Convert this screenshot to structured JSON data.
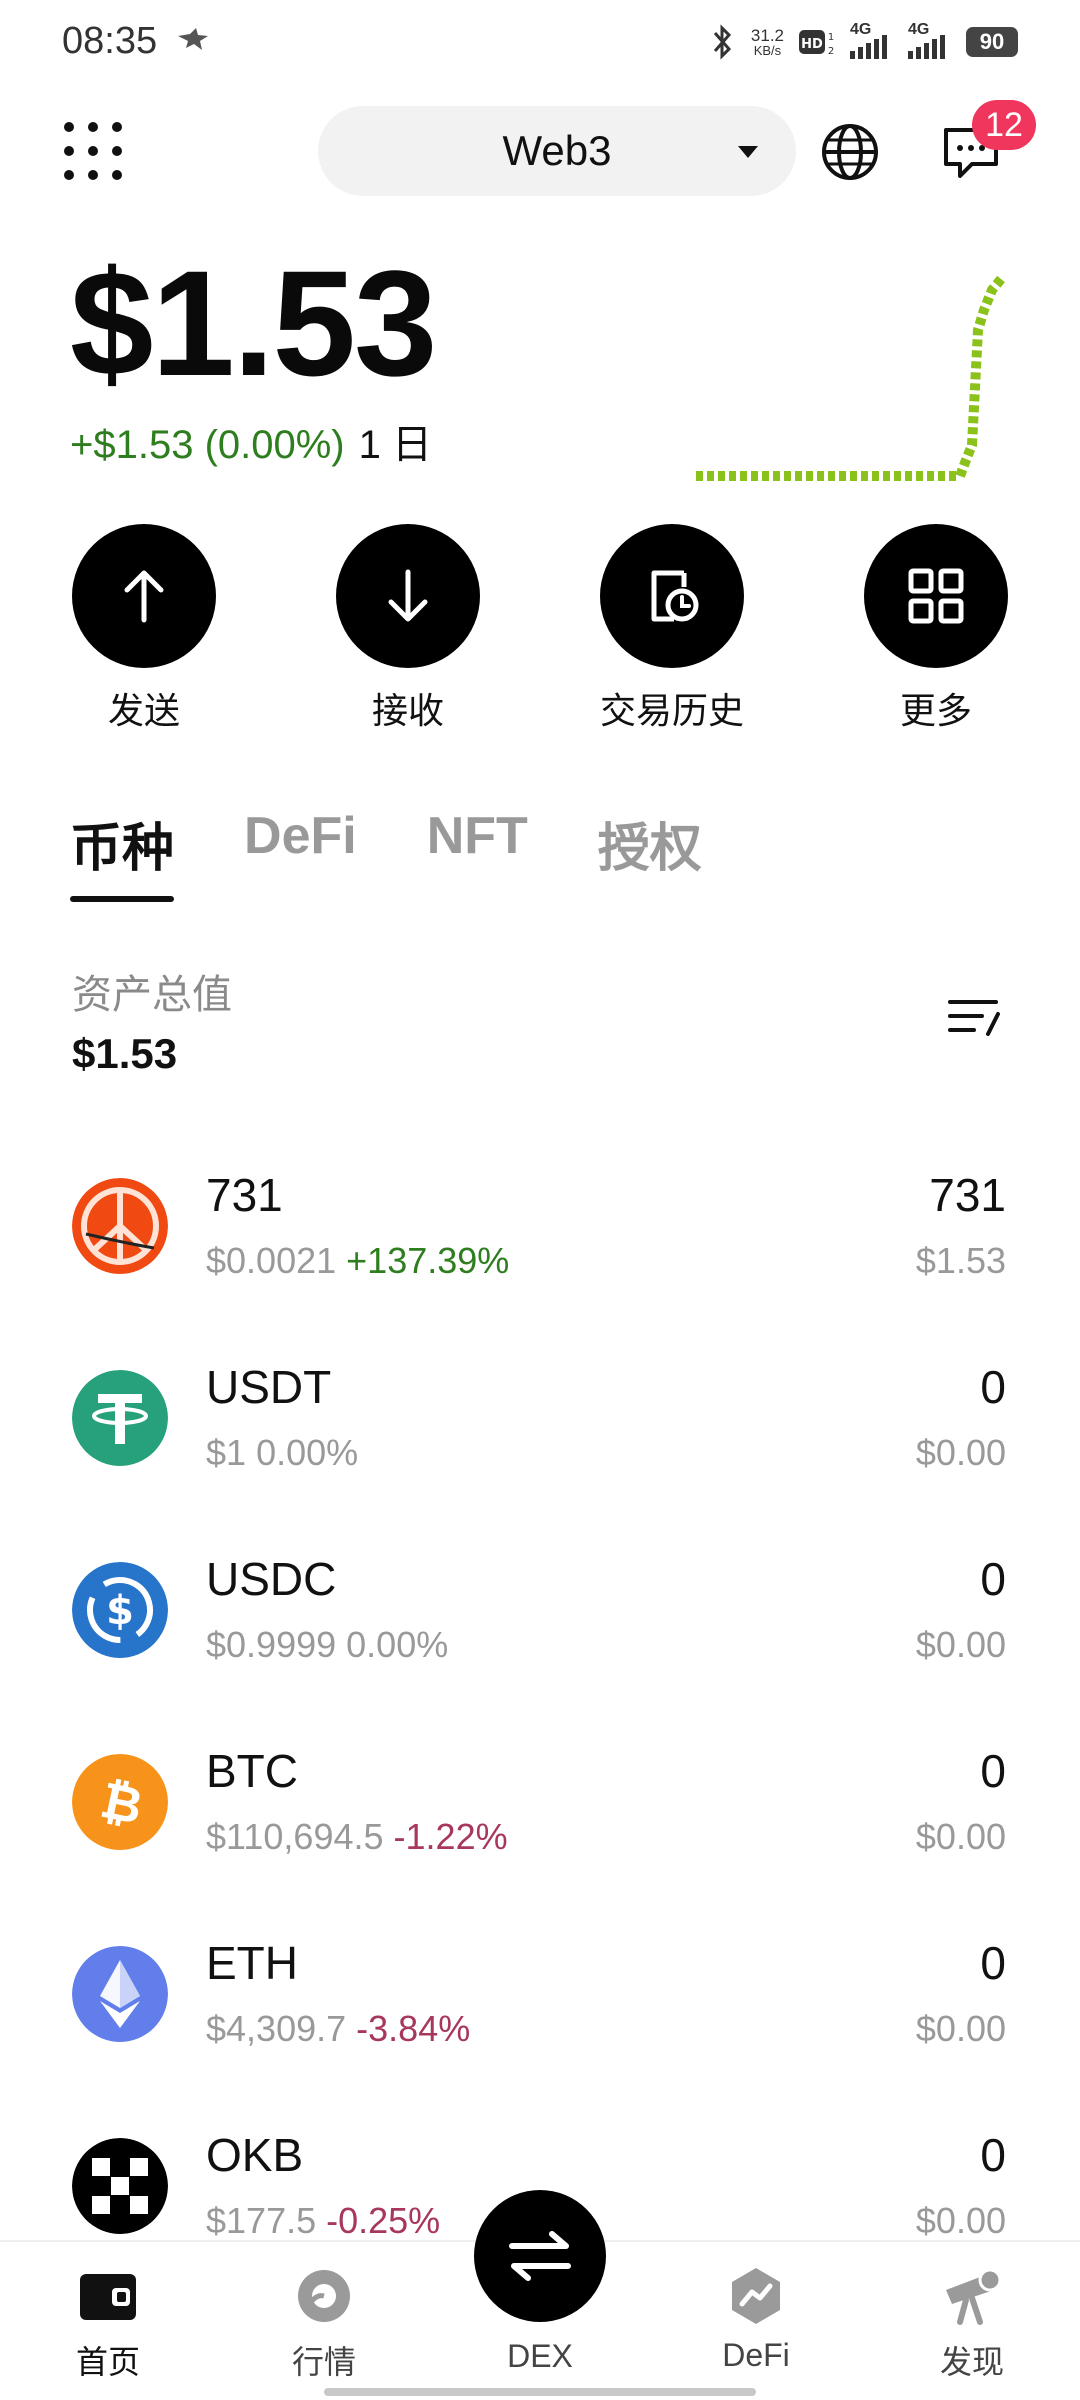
{
  "status_bar": {
    "time": "08:35",
    "net_speed_value": "31.2",
    "net_speed_unit": "KB/s",
    "network_1": "4G",
    "network_2": "4G",
    "battery": "90"
  },
  "header": {
    "wallet_label": "Web3",
    "notification_count": "12"
  },
  "balance": {
    "total": "$1.53",
    "change": "+$1.53 (0.00%)",
    "period": "1 日"
  },
  "actions": [
    {
      "label": "发送",
      "icon": "arrow-up-icon"
    },
    {
      "label": "接收",
      "icon": "arrow-down-icon"
    },
    {
      "label": "交易历史",
      "icon": "history-icon"
    },
    {
      "label": "更多",
      "icon": "grid-icon"
    }
  ],
  "tabs": [
    {
      "label": "币种",
      "active": true
    },
    {
      "label": "DeFi",
      "active": false
    },
    {
      "label": "NFT",
      "active": false
    },
    {
      "label": "授权",
      "active": false
    }
  ],
  "assets": {
    "label": "资产总值",
    "total": "$1.53"
  },
  "tokens": [
    {
      "symbol": "731",
      "price": "$0.0021",
      "change": "+137.39%",
      "amount": "731",
      "value": "$1.53",
      "logo_color": "#f04a12"
    },
    {
      "symbol": "USDT",
      "price": "$1",
      "change": "0.00%",
      "amount": "0",
      "value": "$0.00",
      "logo_color": "#26a17b"
    },
    {
      "symbol": "USDC",
      "price": "$0.9999",
      "change": "0.00%",
      "amount": "0",
      "value": "$0.00",
      "logo_color": "#2775ca"
    },
    {
      "symbol": "BTC",
      "price": "$110,694.5",
      "change": "-1.22%",
      "amount": "0",
      "value": "$0.00",
      "logo_color": "#f7931a"
    },
    {
      "symbol": "ETH",
      "price": "$4,309.7",
      "change": "-3.84%",
      "amount": "0",
      "value": "$0.00",
      "logo_color": "#627eea"
    },
    {
      "symbol": "OKB",
      "price": "$177.5",
      "change": "-0.25%",
      "amount": "0",
      "value": "$0.00",
      "logo_color": "#000000"
    }
  ],
  "bottom_nav": [
    {
      "label": "首页",
      "icon": "wallet-icon",
      "active": true
    },
    {
      "label": "行情",
      "icon": "market-icon",
      "active": false
    },
    {
      "label": "DEX",
      "icon": "swap-icon",
      "active": false
    },
    {
      "label": "DeFi",
      "icon": "defi-icon",
      "active": false
    },
    {
      "label": "发现",
      "icon": "discover-icon",
      "active": false
    }
  ],
  "colors": {
    "positive": "#2e7d1e",
    "negative": "#a8375f",
    "badge": "#f0365c",
    "sparkline": "#8ac11a"
  }
}
